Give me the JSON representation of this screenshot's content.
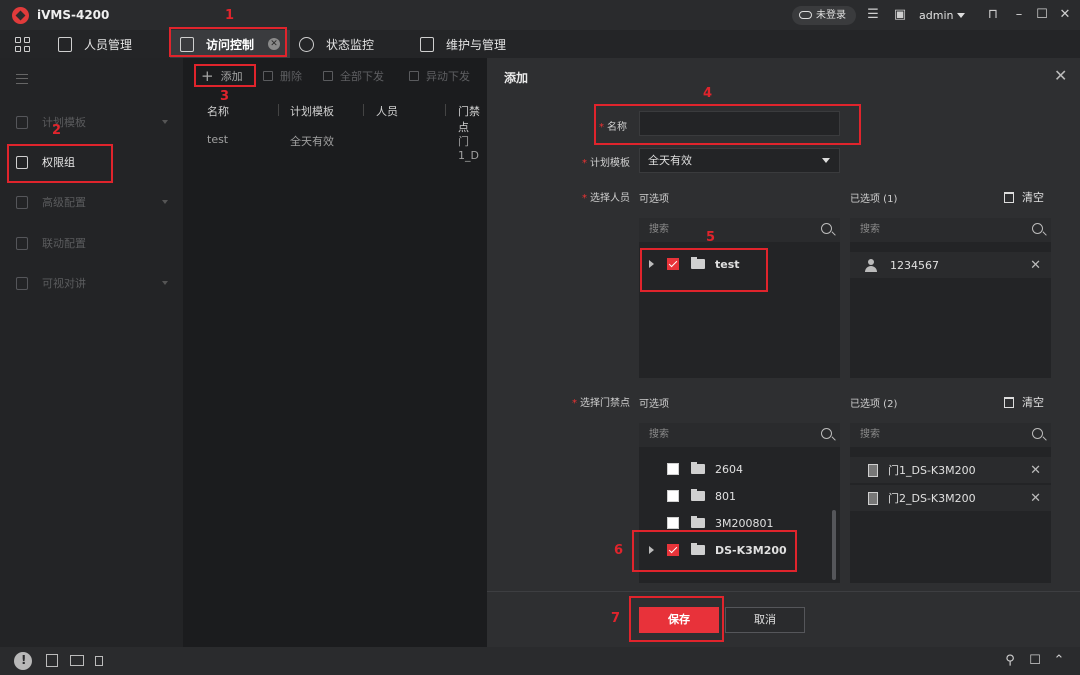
{
  "app": {
    "title": "iVMS-4200",
    "login_status": "未登录",
    "user": "admin"
  },
  "nav": {
    "tabs": [
      {
        "label": "人员管理"
      },
      {
        "label": "访问控制"
      },
      {
        "label": "状态监控"
      },
      {
        "label": "维护与管理"
      }
    ]
  },
  "sidebar": {
    "items": [
      {
        "label": "计划模板"
      },
      {
        "label": "权限组"
      },
      {
        "label": "高级配置"
      },
      {
        "label": "联动配置"
      },
      {
        "label": "可视对讲"
      }
    ]
  },
  "toolbar": {
    "add": "添加",
    "delete": "删除",
    "apply_all": "全部下发",
    "apply_diff": "异动下发"
  },
  "table": {
    "columns": [
      "名称",
      "计划模板",
      "人员",
      "门禁点"
    ],
    "rows": [
      {
        "name": "test",
        "template": "全天有效",
        "door": "门1_D"
      }
    ]
  },
  "dialog": {
    "title": "添加",
    "name_label": "名称",
    "name_value": "",
    "template_label": "计划模板",
    "template_value": "全天有效",
    "person_label": "选择人员",
    "door_label": "选择门禁点",
    "available_label": "可选项",
    "selected_person_label": "已选项 (1)",
    "selected_door_label": "已选项 (2)",
    "clear_label": "清空",
    "search_placeholder": "搜索",
    "person_tree": [
      {
        "label": "test",
        "checked": true
      }
    ],
    "person_selected": [
      "1234567"
    ],
    "door_tree": [
      {
        "label": "2604",
        "checked": false
      },
      {
        "label": "801",
        "checked": false
      },
      {
        "label": "3M200801",
        "checked": false
      },
      {
        "label": "DS-K3M200",
        "checked": true
      }
    ],
    "door_selected": [
      "门1_DS-K3M200",
      "门2_DS-K3M200"
    ],
    "save": "保存",
    "cancel": "取消"
  },
  "annotations": [
    "1",
    "2",
    "3",
    "4",
    "5",
    "6",
    "7"
  ],
  "colors": {
    "accent": "#e8323a",
    "annotation": "#e0242c",
    "background": "#1b1c1e",
    "dialog": "#2e2f31"
  }
}
